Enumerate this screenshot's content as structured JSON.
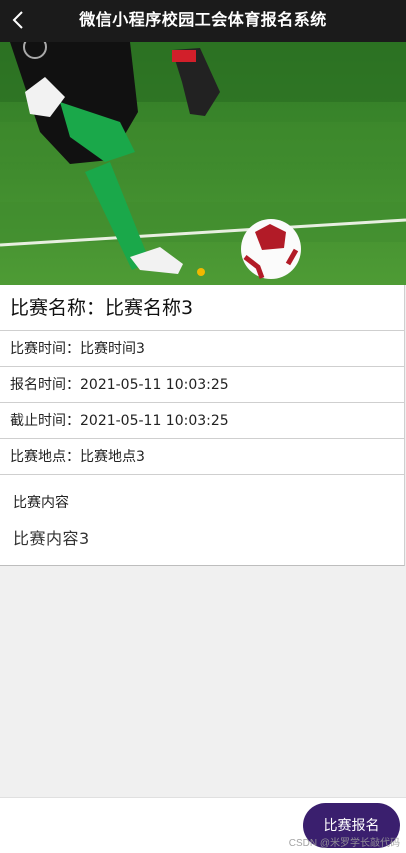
{
  "nav": {
    "title": "微信小程序校园工会体育报名系统",
    "back_icon": "chevron-left-icon"
  },
  "banner": {
    "slides": 1,
    "active_index": 0,
    "colors": {
      "dot_active": "#f0b800"
    }
  },
  "detail": {
    "name": "比赛名称：比赛名称3",
    "match_time": "比赛时间：比赛时间3",
    "signup_time": "报名时间：2021-05-11 10:03:25",
    "deadline": "截止时间：2021-05-11 10:03:25",
    "location": "比赛地点：比赛地点3",
    "content_label": "比赛内容",
    "content_text": "比赛内容3"
  },
  "actions": {
    "signup_label": "比赛报名",
    "button_color": "#3a1f6e"
  },
  "watermark": "CSDN @米罗学长敲代码"
}
